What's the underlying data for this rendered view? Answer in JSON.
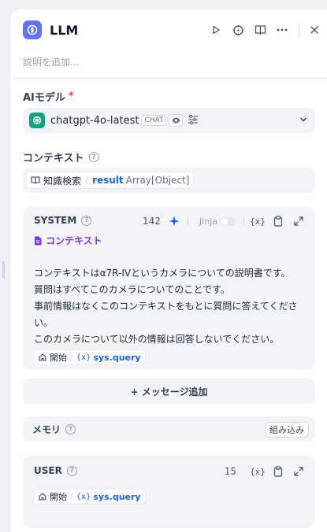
{
  "header": {
    "title": "LLM",
    "description_placeholder": "説明を追加..."
  },
  "model": {
    "label": "AIモデル",
    "required_mark": "*",
    "name": "chatgpt-4o-latest",
    "mode_badge": "CHAT"
  },
  "context": {
    "label": "コンテキスト",
    "variable": {
      "node": "知識検索",
      "name": "result",
      "type": "Array[Object]"
    }
  },
  "system_prompt": {
    "role": "SYSTEM",
    "token_count": "142",
    "jinja_label": "Jinja",
    "context_tag": "コンテキスト",
    "lines": [
      "コンテキストはα7R-IVというカメラについての説明書です。",
      "質問はすべてこのカメラについてのことです。",
      "事前情報はなくこのコンテキストをもとに質問に答えてください。",
      "このカメラについて以外の情報は回答しないでください。"
    ],
    "var_node": "開始",
    "var_name": "sys.query"
  },
  "add_message_label": "+ メッセージ追加",
  "memory": {
    "label": "メモリ",
    "builtin_label": "組み込み"
  },
  "user_prompt": {
    "role": "USER",
    "token_count": "15",
    "var_node": "開始",
    "var_name": "sys.query"
  },
  "colors": {
    "app_icon": "#6172f3",
    "gpt_icon": "#10a37f",
    "link_blue": "#155eef",
    "context_purple": "#7839ee"
  }
}
